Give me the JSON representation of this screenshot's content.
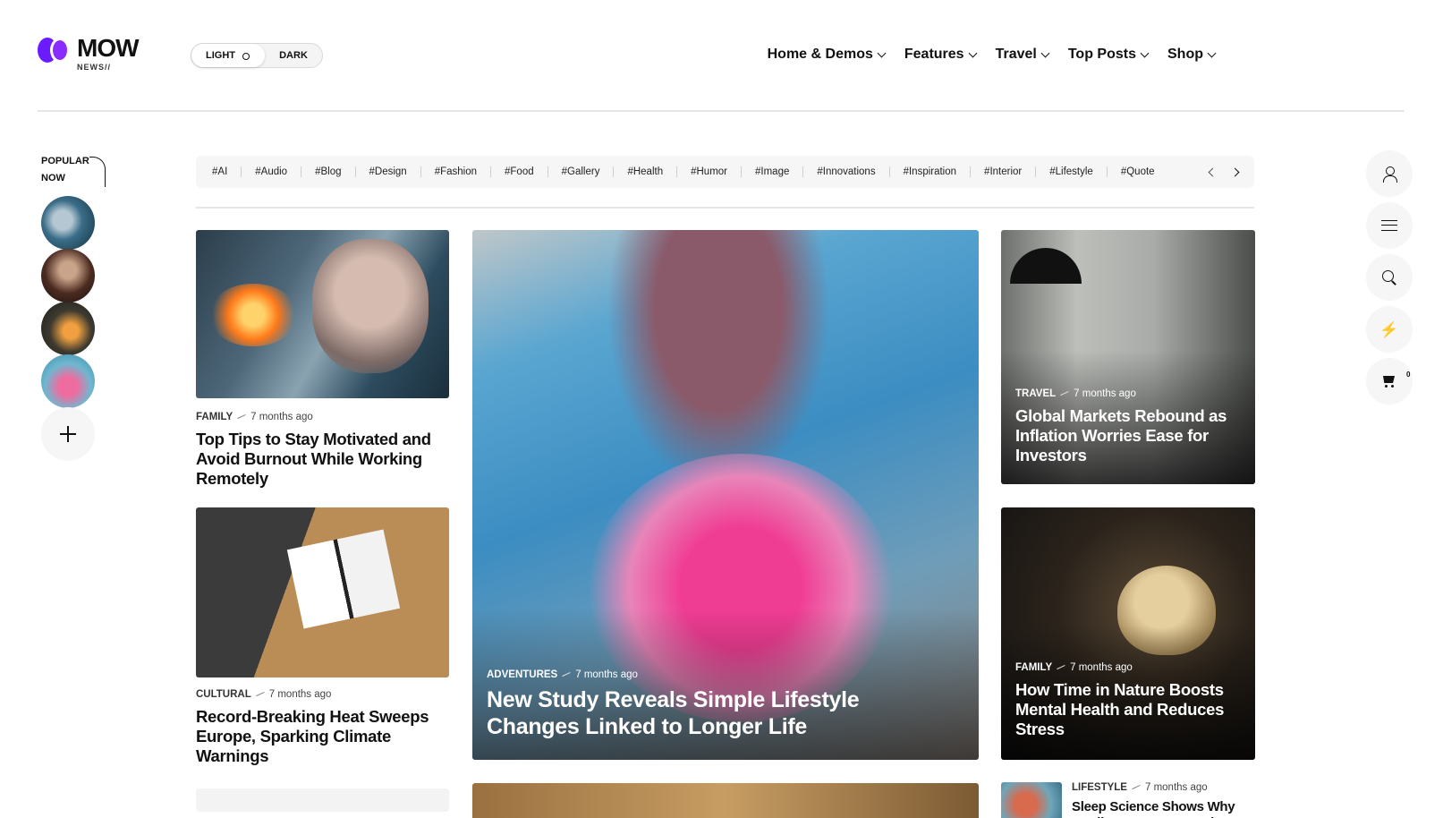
{
  "header": {
    "logo_word": "MOW",
    "logo_sub": "NEWS//",
    "theme": {
      "light": "LIGHT",
      "dark": "DARK"
    },
    "nav": [
      "Home & Demos",
      "Features",
      "Travel",
      "Top Posts",
      "Shop"
    ]
  },
  "popular": {
    "label_line1": "POPULAR",
    "label_line2": "NOW"
  },
  "tags": [
    "#AI",
    "#Audio",
    "#Blog",
    "#Design",
    "#Fashion",
    "#Food",
    "#Gallery",
    "#Health",
    "#Humor",
    "#Image",
    "#Innovations",
    "#Inspiration",
    "#Interior",
    "#Lifestyle",
    "#Quote"
  ],
  "tools": {
    "cart_count": "0"
  },
  "cards": {
    "card1": {
      "category": "FAMILY",
      "time": "7 months ago",
      "title": "Top Tips to Stay Motivated and Avoid Burnout While Working Remotely"
    },
    "card2": {
      "category": "CULTURAL",
      "time": "7 months ago",
      "title": "Record-Breaking Heat Sweeps Europe, Sparking Climate Warnings"
    },
    "feature": {
      "category": "ADVENTURES",
      "time": "7 months ago",
      "title": "New Study Reveals Simple Lifestyle Changes Linked to Longer Life"
    },
    "card3": {
      "category": "TRAVEL",
      "time": "7 months ago",
      "title": "Global Markets Rebound as Inflation Worries Ease for Investors"
    },
    "card4": {
      "category": "FAMILY",
      "time": "7 months ago",
      "title": "How Time in Nature Boosts Mental Health and Reduces Stress"
    },
    "card5": {
      "category": "LIFESTYLE",
      "time": "7 months ago",
      "title": "Sleep Science Shows Why Quality Matters More Than"
    }
  }
}
